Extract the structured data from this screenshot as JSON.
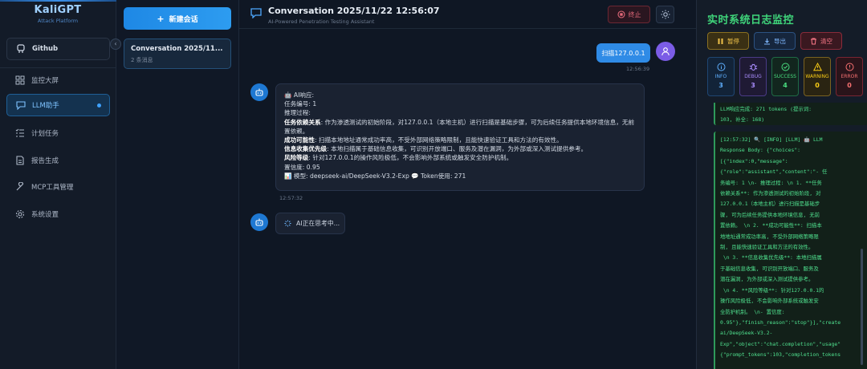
{
  "brand": {
    "name": "KaliGPT",
    "subtitle": "Attack Platform"
  },
  "nav": {
    "github": "Github",
    "items": [
      {
        "label": "监控大屏",
        "icon": "dashboard-icon"
      },
      {
        "label": "LLM助手",
        "icon": "chat-icon"
      },
      {
        "label": "计划任务",
        "icon": "task-list-icon"
      },
      {
        "label": "报告生成",
        "icon": "document-icon"
      },
      {
        "label": "MCP工具管理",
        "icon": "wrench-icon"
      },
      {
        "label": "系统设置",
        "icon": "gear-icon"
      }
    ]
  },
  "conversations": {
    "new_label": "新建会话",
    "items": [
      {
        "title": "Conversation 2025/11...",
        "meta": "2 条消息"
      }
    ]
  },
  "chat": {
    "title": "Conversation 2025/11/22 12:56:07",
    "subtitle": "AI-Powered Penetration Testing Assistant",
    "stop_label": "终止",
    "user_message": "扫描127.0.0.1",
    "user_time": "12:56:39",
    "ai": {
      "header": "🤖 AI响应:",
      "task_no": "任务编号: 1",
      "reasoning": "推理过程:",
      "l1_label": "任务依赖关系",
      "l1_text": ": 作为渗透测试的初始阶段，对127.0.0.1（本地主机）进行扫描是基础步骤，可为后续任务提供本地环境信息，无前置依赖。",
      "l2_label": "成功可能性",
      "l2_text": ": 扫描本地地址通常成功率高，不受外部网络策略限制，且能快速验证工具和方法的有效性。",
      "l3_label": "信息收集优先级",
      "l3_text": ": 本地扫描属于基础信息收集，可识别开放端口、服务及潜在漏洞，为外部或深入测试提供参考。",
      "l4_label": "风险等级",
      "l4_text": ": 针对127.0.0.1的操作风险极低，不会影响外部系统或触发安全防护机制。",
      "confidence": "置信度: 0.95",
      "model_line": "📊 模型: deepseek-ai/DeepSeek-V3.2-Exp 💬 Token使用: 271",
      "time": "12:57:32"
    },
    "thinking": "AI正在思考中..."
  },
  "logs": {
    "title": "实时系统日志监控",
    "pause_label": "暂停",
    "export_label": "导出",
    "clear_label": "清空",
    "stats": [
      {
        "label": "INFO",
        "value": "3"
      },
      {
        "label": "DEBUG",
        "value": "3"
      },
      {
        "label": "SUCCESS",
        "value": "4"
      },
      {
        "label": "WARNING",
        "value": "0"
      },
      {
        "label": "ERROR",
        "value": "0"
      }
    ],
    "entry1": "LLM响应完成: 271 tokens (提示词:\n103, 补全: 168)",
    "entry2": "[12:57:32] 🔍 [INFO] [LLM] 🤖 LLM\nResponse Body: {\"choices\":\n[{\"index\":0,\"message\":\n{\"role\":\"assistant\",\"content\":\"- 任\n务编号: 1 \\n- 推理过程: \\n 1. **任务\n依赖关系**: 作为渗透测试的初始阶段, 对\n127.0.0.1（本地主机）进行扫描是基础步\n骤, 可为后续任务提供本地环境信息, 无前\n置依赖。 \\n 2. **成功可能性**: 扫描本\n地地址通常成功率高, 不受外部网络策略限\n制, 且能快速验证工具和方法的有效性。\n \\n 3. **信息收集优先级**: 本地扫描属\n于基础信息收集, 可识别开放端口、服务及\n潜在漏洞, 为外部或深入测试提供参考。\n \\n 4. **风险等级**: 针对127.0.0.1的\n操作风险极低, 不会影响外部系统或触发安\n全防护机制。 \\n- 置信度:\n0.95\"},\"finish_reason\":\"stop\"}],\"create\nai/DeepSeek-V3.2-\nExp\",\"object\":\"chat.completion\",\"usage\"\n{\"prompt_tokens\":103,\"completion_tokens"
  }
}
